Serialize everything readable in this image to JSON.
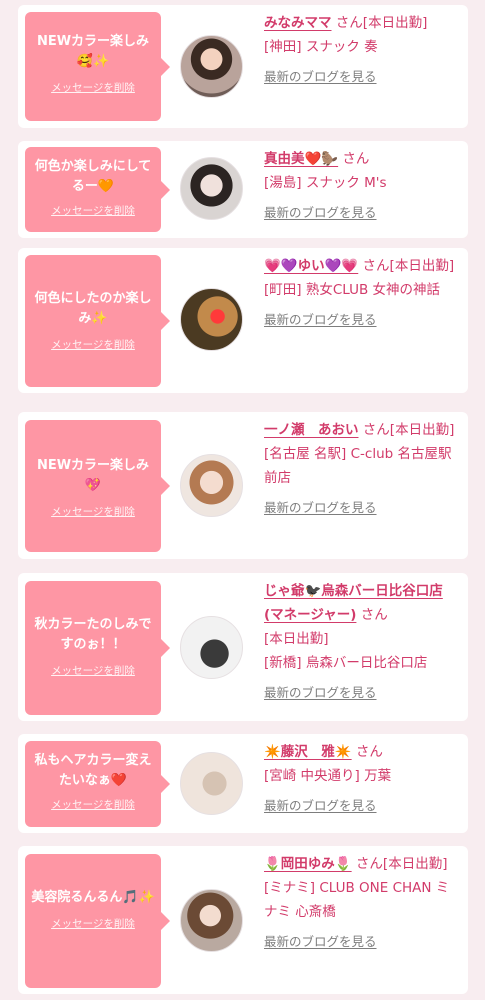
{
  "entries": [
    {
      "message": "NEWカラー楽しみ🥰✨",
      "delete_label": "メッセージを削除",
      "name": "みなみママ",
      "suffix": "さん",
      "status": "[本日出勤]",
      "shop": "[神田] スナック 奏",
      "blog_label": "最新のブログを見る"
    },
    {
      "message": "何色か楽しみにしてるー🧡",
      "delete_label": "メッセージを削除",
      "name": "真由美❤️🦫",
      "suffix": "さん",
      "status": "",
      "shop": "[湯島] スナック M's",
      "blog_label": "最新のブログを見る"
    },
    {
      "message": "何色にしたのか楽しみ✨",
      "delete_label": "メッセージを削除",
      "name": "💗💜ゆい💜💗",
      "suffix": "さん",
      "status": "[本日出勤]",
      "shop": "[町田] 熟女CLUB 女神の神話",
      "blog_label": "最新のブログを見る"
    },
    {
      "message": "NEWカラー楽しみ💖",
      "delete_label": "メッセージを削除",
      "name": "一ノ瀬　あおい",
      "suffix": "さん",
      "status": "[本日出勤]",
      "shop": "[名古屋 名駅] C-club 名古屋駅前店",
      "blog_label": "最新のブログを見る"
    },
    {
      "message": "秋カラーたのしみですのぉ！！",
      "delete_label": "メッセージを削除",
      "name": "じゃ爺🐦‍⬛烏森バー日比谷口店(マネージャー)",
      "suffix": "さん",
      "status": "[本日出勤]",
      "shop": "[新橋] 烏森バー日比谷口店",
      "blog_label": "最新のブログを見る"
    },
    {
      "message": "私もヘアカラー変えたいなぁ❤️",
      "delete_label": "メッセージを削除",
      "name": "✴️藤沢　雅✴️",
      "suffix": "さん",
      "status": "",
      "shop": "[宮崎 中央通り] 万葉",
      "blog_label": "最新のブログを見る"
    },
    {
      "message": "美容院るんるん🎵✨",
      "delete_label": "メッセージを削除",
      "name": "🌷岡田ゆみ🌷",
      "suffix": "さん",
      "status": "[本日出勤]",
      "shop": "[ミナミ] CLUB ONE CHAN ミナミ 心斎橋",
      "blog_label": "最新のブログを見る"
    }
  ]
}
